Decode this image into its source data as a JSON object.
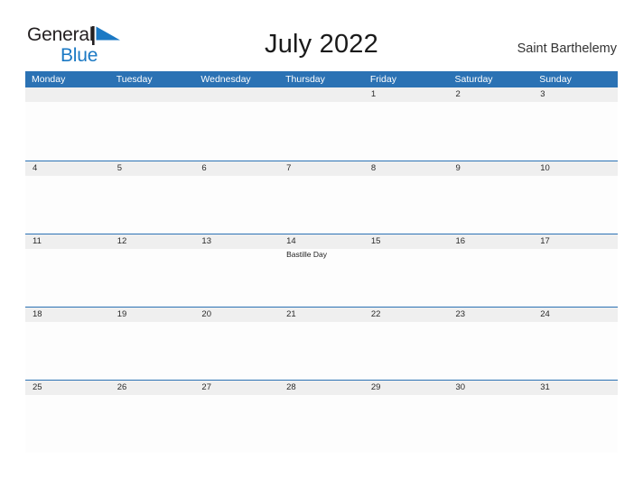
{
  "brand": {
    "name_part1": "General",
    "name_part2": "Blue",
    "flag_icon": "blue-triangle-flag-icon",
    "color_dark": "#231f20",
    "color_blue": "#1b79c4"
  },
  "header": {
    "title": "July 2022",
    "region": "Saint Barthelemy"
  },
  "calendar": {
    "accent_color": "#2b72b4",
    "band_color": "#efefef",
    "weekdays": [
      "Monday",
      "Tuesday",
      "Wednesday",
      "Thursday",
      "Friday",
      "Saturday",
      "Sunday"
    ],
    "weeks": [
      {
        "rule": false,
        "days": [
          {
            "number": "",
            "events": []
          },
          {
            "number": "",
            "events": []
          },
          {
            "number": "",
            "events": []
          },
          {
            "number": "",
            "events": []
          },
          {
            "number": "1",
            "events": []
          },
          {
            "number": "2",
            "events": []
          },
          {
            "number": "3",
            "events": []
          }
        ]
      },
      {
        "rule": true,
        "days": [
          {
            "number": "4",
            "events": []
          },
          {
            "number": "5",
            "events": []
          },
          {
            "number": "6",
            "events": []
          },
          {
            "number": "7",
            "events": []
          },
          {
            "number": "8",
            "events": []
          },
          {
            "number": "9",
            "events": []
          },
          {
            "number": "10",
            "events": []
          }
        ]
      },
      {
        "rule": true,
        "days": [
          {
            "number": "11",
            "events": []
          },
          {
            "number": "12",
            "events": []
          },
          {
            "number": "13",
            "events": []
          },
          {
            "number": "14",
            "events": [
              "Bastille Day"
            ]
          },
          {
            "number": "15",
            "events": []
          },
          {
            "number": "16",
            "events": []
          },
          {
            "number": "17",
            "events": []
          }
        ]
      },
      {
        "rule": true,
        "days": [
          {
            "number": "18",
            "events": []
          },
          {
            "number": "19",
            "events": []
          },
          {
            "number": "20",
            "events": []
          },
          {
            "number": "21",
            "events": []
          },
          {
            "number": "22",
            "events": []
          },
          {
            "number": "23",
            "events": []
          },
          {
            "number": "24",
            "events": []
          }
        ]
      },
      {
        "rule": true,
        "days": [
          {
            "number": "25",
            "events": []
          },
          {
            "number": "26",
            "events": []
          },
          {
            "number": "27",
            "events": []
          },
          {
            "number": "28",
            "events": []
          },
          {
            "number": "29",
            "events": []
          },
          {
            "number": "30",
            "events": []
          },
          {
            "number": "31",
            "events": []
          }
        ]
      }
    ]
  }
}
